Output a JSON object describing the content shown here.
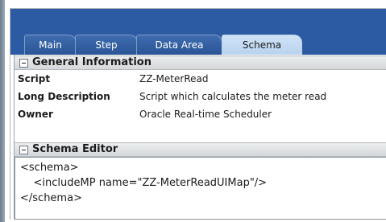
{
  "tabs": [
    {
      "label": "Main"
    },
    {
      "label": "Step"
    },
    {
      "label": "Data Area"
    },
    {
      "label": "Schema",
      "active": true
    }
  ],
  "general_information": {
    "title": "General Information",
    "fields": [
      {
        "label": "Script",
        "value": "ZZ-MeterRead"
      },
      {
        "label": "Long Description",
        "value": "Script which calculates the meter read"
      },
      {
        "label": "Owner",
        "value": "Oracle Real-time Scheduler"
      }
    ]
  },
  "schema_editor": {
    "title": "Schema Editor",
    "lines": [
      "<schema>",
      "    <includeMP name=\"ZZ-MeterReadUIMap\"/>",
      "</schema>"
    ]
  },
  "colors": {
    "tabbar": "#2d5ba3",
    "active_tab": "#c4dbf2",
    "section_header": "#dfe2e5"
  }
}
